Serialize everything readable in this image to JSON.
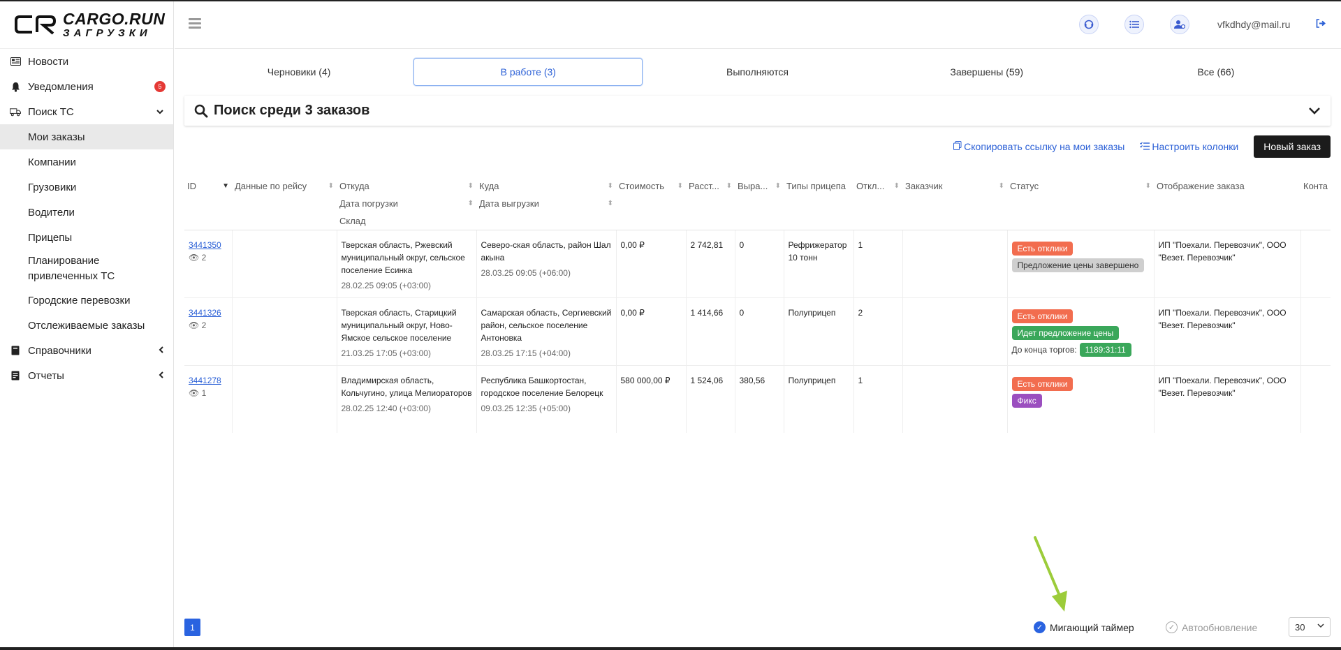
{
  "brand": {
    "line1": "CARGO.RUN",
    "line2": "ЗАГРУЗКИ"
  },
  "sidebar": {
    "items": [
      {
        "label": "Новости",
        "icon": "newspaper-icon"
      },
      {
        "label": "Уведомления",
        "icon": "bell-icon",
        "badge": "5"
      },
      {
        "label": "Поиск ТС",
        "icon": "truck-icon",
        "expanded": true
      },
      {
        "label": "Мои заказы",
        "active": true
      },
      {
        "label": "Компании"
      },
      {
        "label": "Грузовики"
      },
      {
        "label": "Водители"
      },
      {
        "label": "Прицепы"
      },
      {
        "label": "Планирование привлеченных ТС"
      },
      {
        "label": "Городские перевозки"
      },
      {
        "label": "Отслеживаемые заказы"
      },
      {
        "label": "Справочники",
        "icon": "book-icon"
      },
      {
        "label": "Отчеты",
        "icon": "report-icon"
      }
    ]
  },
  "header": {
    "email": "vfkdhdy@mail.ru"
  },
  "tabs": [
    {
      "label": "Черновики (4)"
    },
    {
      "label": "В работе (3)",
      "active": true
    },
    {
      "label": "Выполняются"
    },
    {
      "label": "Завершены (59)"
    },
    {
      "label": "Все (66)"
    }
  ],
  "search": {
    "title": "Поиск среди 3 заказов"
  },
  "actions": {
    "copy_link": "Скопировать ссылку на мои заказы",
    "columns": "Настроить колонки",
    "new_order": "Новый заказ"
  },
  "table": {
    "headers": {
      "id": "ID",
      "trip": "Данные по рейсу",
      "from": "Откуда",
      "load_date": "Дата погрузки",
      "warehouse": "Склад",
      "to": "Куда",
      "unload_date": "Дата выгрузки",
      "cost": "Стоимость",
      "distance": "Расст...",
      "revenue": "Выра...",
      "trailer": "Типы прицепа",
      "responses": "Откл...",
      "customer": "Заказчик",
      "status": "Статус",
      "display": "Отображение заказа",
      "contacts": "Конта"
    },
    "rows": [
      {
        "id": "3441350",
        "views": "2",
        "from": "Тверская область, Ржевский муниципальный округ, сельское поселение Есинка",
        "load_date": "28.02.25 09:05 (+03:00)",
        "to": "Северо-ская область, район Шал акына",
        "unload_date": "28.03.25 09:05 (+06:00)",
        "cost": "0,00 ₽",
        "distance": "2 742,81",
        "revenue": "0",
        "trailer": "Рефрижератор 10 тонн",
        "responses": "1",
        "status1": "Есть отклики",
        "status2": "Предложение цены завершено",
        "display": "ИП \"Поехали. Перевозчик\", ООО \"Везет. Перевозчик\""
      },
      {
        "id": "3441326",
        "views": "2",
        "from": "Тверская область, Старицкий муниципальный округ, Ново-Ямское сельское поселение",
        "load_date": "21.03.25 17:05 (+03:00)",
        "to": "Самарская область, Сергиевский район, сельское поселение Антоновка",
        "unload_date": "28.03.25 17:15 (+04:00)",
        "cost": "0,00 ₽",
        "distance": "1 414,66",
        "revenue": "0",
        "trailer": "Полуприцеп",
        "responses": "2",
        "status1": "Есть отклики",
        "status2": "Идет предложение цены",
        "timer_label": "До конца торгов:",
        "timer_value": "1189:31:11",
        "display": "ИП \"Поехали. Перевозчик\", ООО \"Везет. Перевозчик\""
      },
      {
        "id": "3441278",
        "views": "1",
        "from": "Владимирская область, Кольчугино, улица Мелиораторов",
        "load_date": "28.02.25 12:40 (+03:00)",
        "to": "Республика Башкортостан, городское поселение Белорецк",
        "unload_date": "09.03.25 12:35 (+05:00)",
        "cost": "580 000,00 ₽",
        "distance": "1 524,06",
        "revenue": "380,56",
        "trailer": "Полуприцеп",
        "responses": "1",
        "status1": "Есть отклики",
        "status2": "Фикс",
        "display": "ИП \"Поехали. Перевозчик\", ООО \"Везет. Перевозчик\""
      }
    ]
  },
  "footer": {
    "page": "1",
    "blink_timer": "Мигающий таймер",
    "autorefresh": "Автообновление",
    "per_page": "30"
  },
  "colors": {
    "accent": "#2a63e0",
    "arrow": "#9ccc3a",
    "badge": "#e53935"
  }
}
